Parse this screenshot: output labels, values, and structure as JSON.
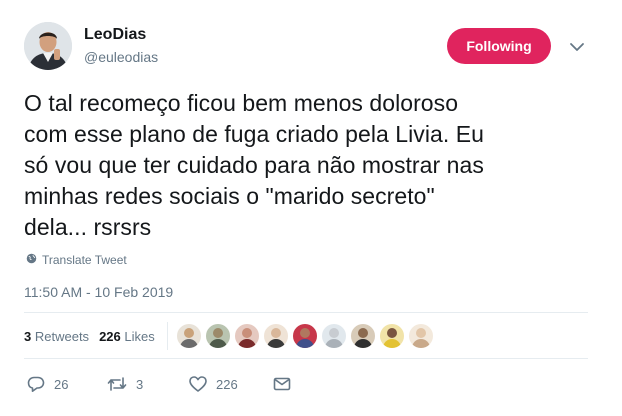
{
  "author": {
    "display_name": "LeoDias",
    "handle": "@euleodias"
  },
  "follow_button": {
    "label": "Following",
    "color": "#e0245e"
  },
  "tweet": {
    "text": "O tal recomeço ficou bem menos doloroso\ncom esse plano de fuga criado pela Livia. Eu\nsó vou que ter cuidado para não mostrar nas\nminhas redes sociais o \"marido secreto\"\ndela... rsrsrs",
    "translate_label": "Translate Tweet",
    "timestamp": "11:50 AM - 10 Feb 2019"
  },
  "stats": {
    "retweets_count": "3",
    "retweets_label": "Retweets",
    "likes_count": "226",
    "likes_label": "Likes"
  },
  "likers": [
    {
      "head": "#c9a27a",
      "body": "#6b6b6b",
      "bg": "#e8e2d8"
    },
    {
      "head": "#9c8a6a",
      "body": "#4e5a4a",
      "bg": "#b9c4b0"
    },
    {
      "head": "#c98f7a",
      "body": "#7a2b2b",
      "bg": "#e5c9c0"
    },
    {
      "head": "#d9b79a",
      "body": "#3a3a3a",
      "bg": "#efe3d6"
    },
    {
      "head": "#b0785f",
      "body": "#3f4f8a",
      "bg": "#c7374a"
    },
    {
      "head": "#c8ccd1",
      "body": "#aab1b8",
      "bg": "#e1e8ed"
    },
    {
      "head": "#8b6a4f",
      "body": "#2f2f2f",
      "bg": "#d8cbb8"
    },
    {
      "head": "#7a5540",
      "body": "#e3c232",
      "bg": "#f1e3a8"
    },
    {
      "head": "#e2c6a8",
      "body": "#c9a98a",
      "bg": "#f3e9dc"
    }
  ],
  "actions": {
    "reply_count": "26",
    "retweet_count": "3",
    "like_count": "226"
  },
  "colors": {
    "primary_text": "#14171a",
    "secondary_text": "#657786",
    "divider": "#e6ecf0"
  }
}
